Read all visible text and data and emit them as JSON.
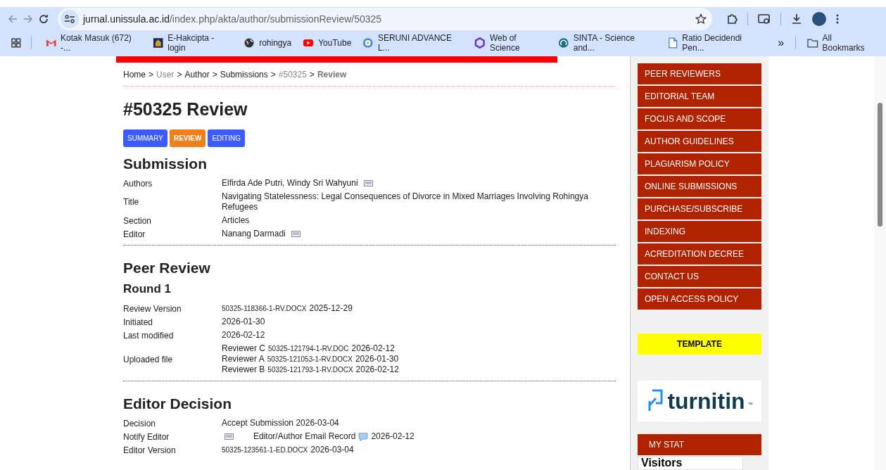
{
  "browser": {
    "url_host": "jurnal.unissula.ac.id",
    "url_path": "/index.php/akta/author/submissionReview/50325",
    "bookmarks": [
      {
        "label": "Kotak Masuk (672) -...",
        "kind": "mail"
      },
      {
        "label": "E-Hakcipta - login",
        "kind": "emblem"
      },
      {
        "label": "rohingya",
        "kind": "globe"
      },
      {
        "label": "YouTube",
        "kind": "play"
      },
      {
        "label": "SERUNI ADVANCE L...",
        "kind": "seal"
      },
      {
        "label": "Web of Science",
        "kind": "hex"
      },
      {
        "label": "SINTA - Science and...",
        "kind": "swirl"
      },
      {
        "label": "Ratio Decidendi Pen...",
        "kind": "doc"
      }
    ],
    "overflow": "»",
    "all_bookmarks": "All Bookmarks"
  },
  "breadcrumb": [
    {
      "label": "Home",
      "kind": "link"
    },
    {
      "label": "User",
      "kind": "muted"
    },
    {
      "label": "Author",
      "kind": "link"
    },
    {
      "label": "Submissions",
      "kind": "link"
    },
    {
      "label": "#50325",
      "kind": "muted"
    },
    {
      "label": "Review",
      "kind": "current"
    }
  ],
  "breadcrumb_separator": ">",
  "page_title": "#50325 Review",
  "tabs": [
    {
      "label": "SUMMARY",
      "selected": false
    },
    {
      "label": "REVIEW",
      "selected": true
    },
    {
      "label": "EDITING",
      "selected": false
    }
  ],
  "sections": [
    {
      "title": "Submission",
      "rows": [
        {
          "label": "Authors",
          "lines": [
            [
              {
                "kind": "text",
                "text": "Elfirda Ade Putri, Windy Sri Wahyuni"
              },
              {
                "kind": "envelope"
              }
            ]
          ]
        },
        {
          "label": "Title",
          "lines": [
            [
              {
                "kind": "text",
                "text": "Navigating Statelessness: Legal Consequences of Divorce in Mixed Marriages Involving Rohingya Refugees"
              }
            ]
          ]
        },
        {
          "label": "Section",
          "lines": [
            [
              {
                "kind": "text",
                "text": "Articles"
              }
            ]
          ]
        },
        {
          "label": "Editor",
          "lines": [
            [
              {
                "kind": "text",
                "text": "Nanang Darmadi"
              },
              {
                "kind": "envelope"
              }
            ]
          ]
        }
      ]
    },
    {
      "title": "Peer Review",
      "subtitle": "Round 1",
      "rows": [
        {
          "label": "Review Version",
          "lines": [
            [
              {
                "kind": "file",
                "text": "50325-118366-1-RV.DOCX"
              },
              {
                "kind": "text",
                "text": "2025-12-29"
              }
            ]
          ]
        },
        {
          "label": "Initiated",
          "lines": [
            [
              {
                "kind": "text",
                "text": "2026-01-30"
              }
            ]
          ]
        },
        {
          "label": "Last modified",
          "lines": [
            [
              {
                "kind": "text",
                "text": "2026-02-12"
              }
            ]
          ]
        },
        {
          "label": "Uploaded file",
          "lines": [
            [
              {
                "kind": "text",
                "text": "Reviewer C"
              },
              {
                "kind": "file",
                "text": "50325-121794-1-RV.DOC"
              },
              {
                "kind": "text",
                "text": "2026-02-12"
              }
            ],
            [
              {
                "kind": "text",
                "text": "Reviewer A"
              },
              {
                "kind": "file",
                "text": "50325-121053-1-RV.DOCX"
              },
              {
                "kind": "text",
                "text": "2026-01-30"
              }
            ],
            [
              {
                "kind": "text",
                "text": "Reviewer B"
              },
              {
                "kind": "file",
                "text": "50325-121793-1-RV.DOCX"
              },
              {
                "kind": "text",
                "text": "2026-02-12"
              }
            ]
          ]
        }
      ]
    },
    {
      "title": "Editor Decision",
      "rows": [
        {
          "label": "Decision",
          "lines": [
            [
              {
                "kind": "text",
                "text": "Accept Submission 2026-03-04"
              }
            ]
          ]
        },
        {
          "label": "Notify Editor",
          "lines": [
            [
              {
                "kind": "envelope"
              },
              {
                "kind": "link",
                "text": "Editor/Author Email Record"
              },
              {
                "kind": "bubble"
              },
              {
                "kind": "text",
                "text": "2026-02-12"
              }
            ]
          ]
        },
        {
          "label": "Editor Version",
          "lines": [
            [
              {
                "kind": "file",
                "text": "50325-123561-1-ED.DOCX"
              },
              {
                "kind": "text",
                "text": "2026-03-04"
              }
            ]
          ]
        }
      ]
    }
  ],
  "sidebar": {
    "nav": [
      "PEER REVIEWERS",
      "EDITORIAL TEAM",
      "FOCUS AND SCOPE",
      "AUTHOR GUIDELINES",
      "PLAGIARISM POLICY",
      "ONLINE SUBMISSIONS",
      "PURCHASE/SUBSCRIBE",
      "INDEXING",
      "ACREDITATION DECREE",
      "CONTACT US",
      "OPEN ACCESS POLICY"
    ],
    "template": "TEMPLATE",
    "logo_text": "turnitin",
    "logo_mark": "™",
    "stat_title": "MY STAT",
    "visitors": "Visitors"
  }
}
